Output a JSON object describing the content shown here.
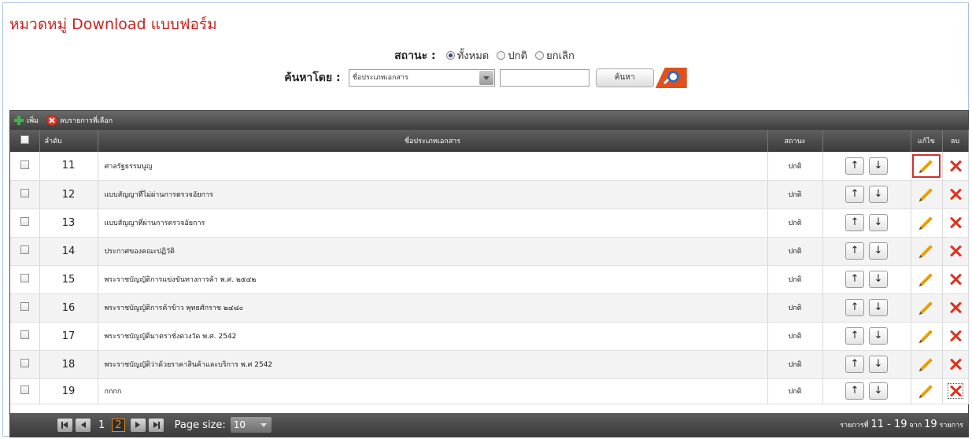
{
  "page": {
    "title": "หมวดหมู่ Download แบบฟอร์ม"
  },
  "filters": {
    "status_label": "สถานะ :",
    "status_options": [
      {
        "label": "ทั้งหมด",
        "checked": true
      },
      {
        "label": "ปกติ",
        "checked": false
      },
      {
        "label": "ยกเลิก",
        "checked": false
      }
    ],
    "search_by_label": "ค้นหาโดย :",
    "search_field_selected": "ชื่อประเภทเอกสาร",
    "search_text_value": "",
    "search_button_label": "ค้นหา"
  },
  "toolbar": {
    "add_label": "เพิ่ม",
    "delete_selected_label": "ลบรายการที่เลือก"
  },
  "table": {
    "columns": {
      "seq": "ลำดับ",
      "name": "ชื่อประเภทเอกสาร",
      "status": "สถานะ",
      "edit": "แก้ไข",
      "delete": "ลบ"
    },
    "rows": [
      {
        "seq": "11",
        "name": "ศาลรัฐธรรมนูญ",
        "status": "ปกติ"
      },
      {
        "seq": "12",
        "name": "แบบสัญญาที่ไม่ผ่านการตรวจอัยการ",
        "status": "ปกติ"
      },
      {
        "seq": "13",
        "name": "แบบสัญญาที่ผ่านการตรวจอัยการ",
        "status": "ปกติ"
      },
      {
        "seq": "14",
        "name": "ประกาศของคณะปฏิวัติ",
        "status": "ปกติ"
      },
      {
        "seq": "15",
        "name": "พระราชบัญญัติการแข่งขันทางการค้า พ.ศ. ๒๕๔๒",
        "status": "ปกติ"
      },
      {
        "seq": "16",
        "name": "พระราชบัญญัติการค้าข้าว พุทธศักราช ๒๔๘๐",
        "status": "ปกติ"
      },
      {
        "seq": "17",
        "name": "พระราชบัญญัติมาตราชั่งตวงวัด พ.ศ. 2542",
        "status": "ปกติ"
      },
      {
        "seq": "18",
        "name": "พระราชบัญญัติว่าด้วยราคาสินค้าและบริการ พ.ศ 2542",
        "status": "ปกติ"
      },
      {
        "seq": "19",
        "name": "กกกก",
        "status": "ปกติ"
      }
    ],
    "move_up_glyph": "↑",
    "move_down_glyph": "↓"
  },
  "pager": {
    "pages": [
      "1",
      "2"
    ],
    "current_page": "2",
    "page_size_label": "Page size:",
    "page_size_value": "10",
    "summary_prefix": "รายการที่",
    "summary_range": "11 - 19",
    "summary_of": "จาก",
    "summary_total": "19",
    "summary_suffix": "รายการ"
  },
  "colors": {
    "title": "#cc2222",
    "grid_header": "#4a4a4a",
    "delete": "#e0301e",
    "edit": "#f0a500",
    "current_page": "#e0891f"
  },
  "icons": [
    "add-icon",
    "delete-selected-icon",
    "search-icon",
    "edit-pencil-icon",
    "delete-x-icon",
    "first-page-icon",
    "prev-page-icon",
    "next-page-icon",
    "last-page-icon"
  ]
}
